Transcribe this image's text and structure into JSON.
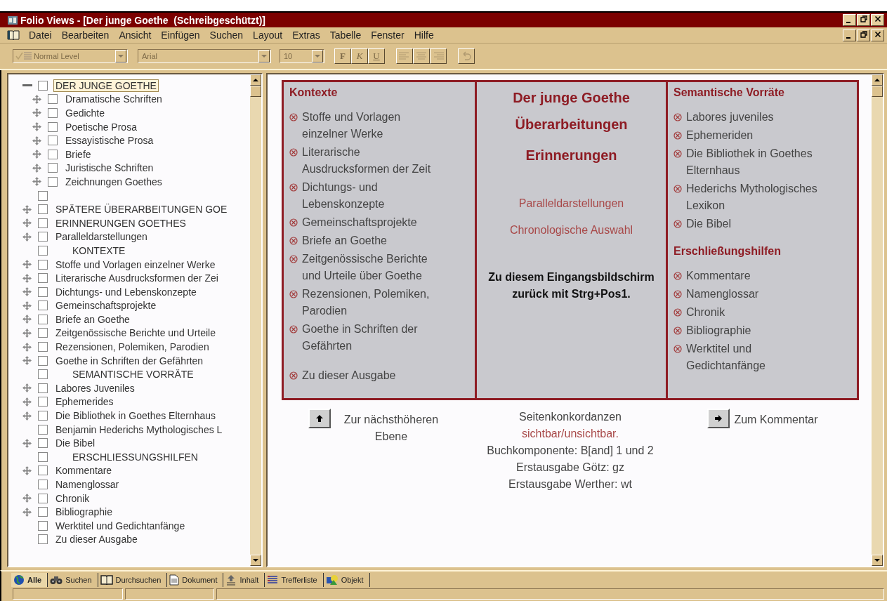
{
  "window": {
    "title": "Folio Views - [Der junge Goethe  (Schreibgeschützt)]"
  },
  "menu": [
    {
      "label": "Datei"
    },
    {
      "label": "Bearbeiten"
    },
    {
      "label": "Ansicht"
    },
    {
      "label": "Einfügen"
    },
    {
      "label": "Suchen"
    },
    {
      "label": "Layout"
    },
    {
      "label": "Extras"
    },
    {
      "label": "Tabelle"
    },
    {
      "label": "Fenster"
    },
    {
      "label": "Hilfe"
    }
  ],
  "toolbar": {
    "style_box": {
      "value": "Normal Level",
      "disabled": true
    },
    "font_box": {
      "value": "Arial",
      "disabled": true
    },
    "size_box": {
      "value": "10",
      "disabled": true
    },
    "buttons": [
      {
        "kind": "bold",
        "label": "F",
        "disabled": true
      },
      {
        "kind": "italic",
        "label": "K",
        "disabled": true
      },
      {
        "kind": "underline",
        "label": "U",
        "disabled": true
      },
      {
        "kind": "align-left",
        "disabled": true
      },
      {
        "kind": "align-center",
        "disabled": true
      },
      {
        "kind": "align-right",
        "disabled": true
      },
      {
        "kind": "undo",
        "disabled": true
      }
    ]
  },
  "tree": [
    {
      "label": "DER JUNGE GOETHE",
      "expanded": true,
      "checked": false,
      "selected": true,
      "children": [
        {
          "label": "Dramatische Schriften",
          "expanded": false,
          "checked": false,
          "selected": false
        },
        {
          "label": "Gedichte",
          "expanded": false,
          "checked": false,
          "selected": false
        },
        {
          "label": "Poetische Prosa",
          "expanded": false,
          "checked": false,
          "selected": false
        },
        {
          "label": "Essayistische Prosa",
          "expanded": false,
          "checked": false,
          "selected": false
        },
        {
          "label": "Briefe",
          "expanded": false,
          "checked": false,
          "selected": false
        },
        {
          "label": "Juristische Schriften",
          "expanded": false,
          "checked": false,
          "selected": false
        },
        {
          "label": "Zeichnungen Goethes",
          "expanded": false,
          "checked": false,
          "selected": false
        }
      ]
    },
    {
      "checked": false,
      "selected": false
    },
    {
      "label": "SPÄTERE ÜBERARBEITUNGEN GOE",
      "expanded": false,
      "checked": false,
      "selected": false
    },
    {
      "label": "ERINNERUNGEN GOETHES",
      "expanded": false,
      "checked": false,
      "selected": false
    },
    {
      "label": "Paralleldarstellungen",
      "expanded": false,
      "checked": false,
      "selected": false
    },
    {
      "label": "KONTEXTE",
      "kind": "heading",
      "checked": false,
      "selected": false
    },
    {
      "label": "Stoffe und Vorlagen einzelner Werke",
      "expanded": false,
      "checked": false,
      "selected": false
    },
    {
      "label": "Literarische Ausdrucksformen der Zei",
      "expanded": false,
      "checked": false,
      "selected": false
    },
    {
      "label": "Dichtungs- und Lebenskonzepte",
      "expanded": false,
      "checked": false,
      "selected": false
    },
    {
      "label": "Gemeinschaftsprojekte",
      "expanded": false,
      "checked": false,
      "selected": false
    },
    {
      "label": "Briefe an Goethe",
      "expanded": false,
      "checked": false,
      "selected": false
    },
    {
      "label": "Zeitgenössische Berichte und Urteile",
      "expanded": false,
      "checked": false,
      "selected": false
    },
    {
      "label": "Rezensionen, Polemiken, Parodien",
      "expanded": false,
      "checked": false,
      "selected": false
    },
    {
      "label": "Goethe in Schriften der Gefährten",
      "expanded": false,
      "checked": false,
      "selected": false
    },
    {
      "label": "SEMANTISCHE VORRÄTE",
      "kind": "heading",
      "checked": false,
      "selected": false
    },
    {
      "label": "Labores Juveniles",
      "expanded": false,
      "checked": false,
      "selected": false
    },
    {
      "label": "Ephemerides",
      "expanded": false,
      "checked": false,
      "selected": false
    },
    {
      "label": "Die Bibliothek in Goethes Elternhaus",
      "expanded": false,
      "checked": false,
      "selected": false
    },
    {
      "label": "Benjamin Hederichs Mythologisches L",
      "checked": false,
      "selected": false
    },
    {
      "label": "Die Bibel",
      "expanded": false,
      "checked": false,
      "selected": false
    },
    {
      "label": "ERSCHLIESSUNGSHILFEN",
      "kind": "heading",
      "checked": false,
      "selected": false
    },
    {
      "label": "Kommentare",
      "expanded": false,
      "checked": false,
      "selected": false
    },
    {
      "label": "Namenglossar",
      "checked": false,
      "selected": false
    },
    {
      "label": "Chronik",
      "expanded": false,
      "checked": false,
      "selected": false
    },
    {
      "label": "Bibliographie",
      "expanded": false,
      "checked": false,
      "selected": false
    },
    {
      "label": "Werktitel und Gedichtanfänge",
      "checked": false,
      "selected": false
    },
    {
      "label": "Zu dieser Ausgabe",
      "checked": false,
      "selected": false
    }
  ],
  "document": {
    "columns": [
      {
        "kind": "index",
        "sections": [
          {
            "heading": "Kontexte",
            "links": [
              "Stoffe und Vorlagen einzelner Werke",
              "Literarische Ausdrucksformen der Zeit",
              "Dichtungs- und Lebenskonzepte",
              "Gemeinschaftsprojekte",
              "Briefe an Goethe",
              "Zeitgenössische Berichte und Urteile über Goethe",
              "Rezensionen, Polemiken, Parodien",
              "Goethe in Schriften der Gefährten"
            ]
          },
          {
            "links": [
              "Zu dieser Ausgabe"
            ]
          }
        ]
      },
      {
        "kind": "title",
        "titles": [
          "Der junge Goethe",
          "Überarbeitungen",
          "Erinnerungen"
        ],
        "links": [
          "Paralleldarstellungen",
          "Chronologische Auswahl"
        ],
        "note": "Zu diesem Eingangsbildschirm zurück mit Strg+Pos1."
      },
      {
        "kind": "index",
        "sections": [
          {
            "heading": "Semantische Vorräte",
            "links": [
              "Labores juveniles",
              "Ephemeriden",
              "Die Bibliothek in Goethes Elternhaus",
              "Hederichs Mythologisches Lexikon",
              "Die Bibel"
            ]
          },
          {
            "heading": "Erschließungshilfen",
            "links": [
              "Kommentare",
              "Namenglossar",
              "Chronik",
              "Bibliographie",
              "Werktitel und Gedichtanfänge"
            ]
          }
        ]
      }
    ],
    "navigation": [
      {
        "kind": "up",
        "label": "Zur nächsthöheren Ebene"
      },
      {
        "kind": "info",
        "lines": [
          {
            "kind": "text",
            "text": "Seitenkonkordanzen"
          },
          {
            "kind": "link",
            "text": "sichtbar/unsichtbar."
          },
          {
            "kind": "text",
            "text": "Buchkomponente: B[and] 1 und 2"
          },
          {
            "kind": "text",
            "text": "Erstausgabe Götz: gz"
          },
          {
            "kind": "text",
            "text": "Erstausgabe Werther: wt"
          }
        ]
      },
      {
        "kind": "next",
        "label": "Zum Kommentar"
      }
    ]
  },
  "tabs": [
    {
      "label": "Alle",
      "kind": "globe",
      "selected": true
    },
    {
      "label": "Suchen",
      "kind": "binoculars",
      "selected": false
    },
    {
      "label": "Durchsuchen",
      "kind": "book",
      "selected": false
    },
    {
      "label": "Dokument",
      "kind": "page",
      "selected": false
    },
    {
      "label": "Inhalt",
      "kind": "contents",
      "selected": false
    },
    {
      "label": "Trefferliste",
      "kind": "list",
      "selected": false
    },
    {
      "label": "Objekt",
      "kind": "object",
      "selected": false
    }
  ]
}
